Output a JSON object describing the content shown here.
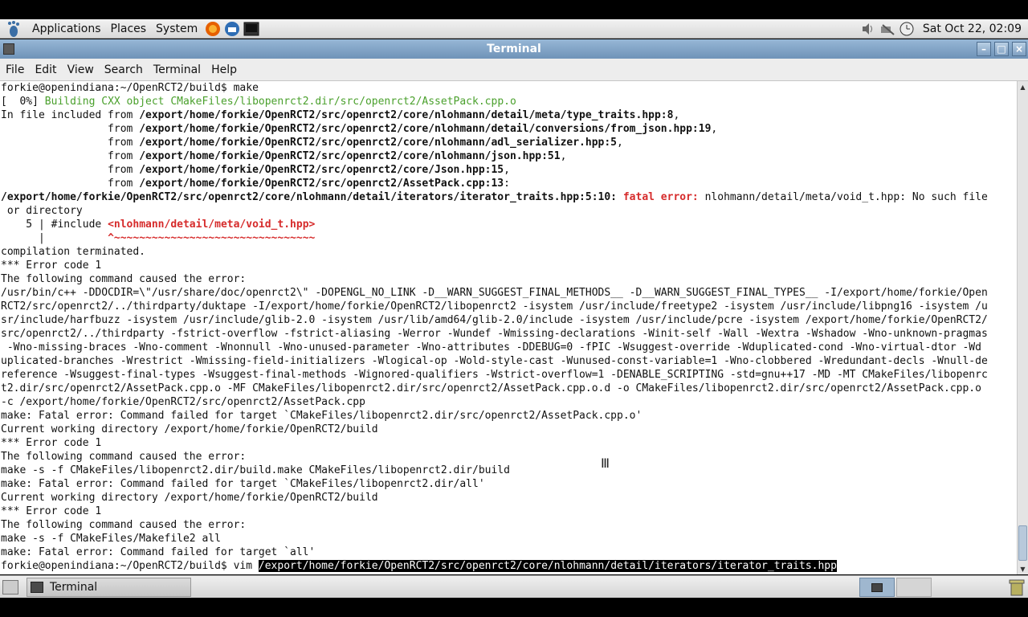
{
  "top_panel": {
    "menus": [
      "Applications",
      "Places",
      "System"
    ],
    "clock": "Sat Oct 22, 02:09"
  },
  "window": {
    "title": "Terminal"
  },
  "menubar": {
    "items": [
      "File",
      "Edit",
      "View",
      "Search",
      "Terminal",
      "Help"
    ]
  },
  "terminal": {
    "lines": [
      {
        "parts": [
          {
            "t": "forkie@openindiana:~/OpenRCT2/build$ make",
            "c": ""
          }
        ]
      },
      {
        "parts": [
          {
            "t": "[  0%] ",
            "c": ""
          },
          {
            "t": "Building CXX object CMakeFiles/libopenrct2.dir/src/openrct2/AssetPack.cpp.o",
            "c": "g"
          }
        ]
      },
      {
        "parts": [
          {
            "t": "In file included from ",
            "c": ""
          },
          {
            "t": "/export/home/forkie/OpenRCT2/src/openrct2/core/nlohmann/detail/meta/type_traits.hpp:8",
            "c": "b"
          },
          {
            "t": ",",
            "c": ""
          }
        ]
      },
      {
        "parts": [
          {
            "t": "                 from ",
            "c": ""
          },
          {
            "t": "/export/home/forkie/OpenRCT2/src/openrct2/core/nlohmann/detail/conversions/from_json.hpp:19",
            "c": "b"
          },
          {
            "t": ",",
            "c": ""
          }
        ]
      },
      {
        "parts": [
          {
            "t": "                 from ",
            "c": ""
          },
          {
            "t": "/export/home/forkie/OpenRCT2/src/openrct2/core/nlohmann/adl_serializer.hpp:5",
            "c": "b"
          },
          {
            "t": ",",
            "c": ""
          }
        ]
      },
      {
        "parts": [
          {
            "t": "                 from ",
            "c": ""
          },
          {
            "t": "/export/home/forkie/OpenRCT2/src/openrct2/core/nlohmann/json.hpp:51",
            "c": "b"
          },
          {
            "t": ",",
            "c": ""
          }
        ]
      },
      {
        "parts": [
          {
            "t": "                 from ",
            "c": ""
          },
          {
            "t": "/export/home/forkie/OpenRCT2/src/openrct2/core/Json.hpp:15",
            "c": "b"
          },
          {
            "t": ",",
            "c": ""
          }
        ]
      },
      {
        "parts": [
          {
            "t": "                 from ",
            "c": ""
          },
          {
            "t": "/export/home/forkie/OpenRCT2/src/openrct2/AssetPack.cpp:13",
            "c": "b"
          },
          {
            "t": ":",
            "c": ""
          }
        ]
      },
      {
        "parts": [
          {
            "t": "/export/home/forkie/OpenRCT2/src/openrct2/core/nlohmann/detail/iterators/iterator_traits.hpp:5:10: ",
            "c": "b"
          },
          {
            "t": "fatal error: ",
            "c": "red"
          },
          {
            "t": "nlohmann/detail/meta/void_t.hpp: No such file",
            "c": ""
          }
        ]
      },
      {
        "parts": [
          {
            "t": " or directory",
            "c": ""
          }
        ]
      },
      {
        "parts": [
          {
            "t": "    5 | #include ",
            "c": ""
          },
          {
            "t": "<nlohmann/detail/meta/void_t.hpp>",
            "c": "red"
          }
        ]
      },
      {
        "parts": [
          {
            "t": "      |          ",
            "c": ""
          },
          {
            "t": "^~~~~~~~~~~~~~~~~~~~~~~~~~~~~~~~~",
            "c": "red"
          }
        ]
      },
      {
        "parts": [
          {
            "t": "compilation terminated.",
            "c": ""
          }
        ]
      },
      {
        "parts": [
          {
            "t": "*** Error code 1",
            "c": ""
          }
        ]
      },
      {
        "parts": [
          {
            "t": "The following command caused the error:",
            "c": ""
          }
        ]
      },
      {
        "parts": [
          {
            "t": "/usr/bin/c++ -DDOCDIR=\\\"/usr/share/doc/openrct2\\\" -DOPENGL_NO_LINK -D__WARN_SUGGEST_FINAL_METHODS__ -D__WARN_SUGGEST_FINAL_TYPES__ -I/export/home/forkie/Open",
            "c": ""
          }
        ]
      },
      {
        "parts": [
          {
            "t": "RCT2/src/openrct2/../thirdparty/duktape -I/export/home/forkie/OpenRCT2/libopenrct2 -isystem /usr/include/freetype2 -isystem /usr/include/libpng16 -isystem /u",
            "c": ""
          }
        ]
      },
      {
        "parts": [
          {
            "t": "sr/include/harfbuzz -isystem /usr/include/glib-2.0 -isystem /usr/lib/amd64/glib-2.0/include -isystem /usr/include/pcre -isystem /export/home/forkie/OpenRCT2/",
            "c": ""
          }
        ]
      },
      {
        "parts": [
          {
            "t": "src/openrct2/../thirdparty -fstrict-overflow -fstrict-aliasing -Werror -Wundef -Wmissing-declarations -Winit-self -Wall -Wextra -Wshadow -Wno-unknown-pragmas",
            "c": ""
          }
        ]
      },
      {
        "parts": [
          {
            "t": " -Wno-missing-braces -Wno-comment -Wnonnull -Wno-unused-parameter -Wno-attributes -DDEBUG=0 -fPIC -Wsuggest-override -Wduplicated-cond -Wno-virtual-dtor -Wd",
            "c": ""
          }
        ]
      },
      {
        "parts": [
          {
            "t": "uplicated-branches -Wrestrict -Wmissing-field-initializers -Wlogical-op -Wold-style-cast -Wunused-const-variable=1 -Wno-clobbered -Wredundant-decls -Wnull-de",
            "c": ""
          }
        ]
      },
      {
        "parts": [
          {
            "t": "reference -Wsuggest-final-types -Wsuggest-final-methods -Wignored-qualifiers -Wstrict-overflow=1 -DENABLE_SCRIPTING -std=gnu++17 -MD -MT CMakeFiles/libopenrc",
            "c": ""
          }
        ]
      },
      {
        "parts": [
          {
            "t": "t2.dir/src/openrct2/AssetPack.cpp.o -MF CMakeFiles/libopenrct2.dir/src/openrct2/AssetPack.cpp.o.d -o CMakeFiles/libopenrct2.dir/src/openrct2/AssetPack.cpp.o",
            "c": ""
          }
        ]
      },
      {
        "parts": [
          {
            "t": "-c /export/home/forkie/OpenRCT2/src/openrct2/AssetPack.cpp",
            "c": ""
          }
        ]
      },
      {
        "parts": [
          {
            "t": "make: Fatal error: Command failed for target `CMakeFiles/libopenrct2.dir/src/openrct2/AssetPack.cpp.o'",
            "c": ""
          }
        ]
      },
      {
        "parts": [
          {
            "t": "Current working directory /export/home/forkie/OpenRCT2/build",
            "c": ""
          }
        ]
      },
      {
        "parts": [
          {
            "t": "*** Error code 1",
            "c": ""
          }
        ]
      },
      {
        "parts": [
          {
            "t": "The following command caused the error:",
            "c": ""
          }
        ]
      },
      {
        "parts": [
          {
            "t": "make -s -f CMakeFiles/libopenrct2.dir/build.make CMakeFiles/libopenrct2.dir/build",
            "c": ""
          }
        ]
      },
      {
        "parts": [
          {
            "t": "make: Fatal error: Command failed for target `CMakeFiles/libopenrct2.dir/all'",
            "c": ""
          }
        ]
      },
      {
        "parts": [
          {
            "t": "Current working directory /export/home/forkie/OpenRCT2/build",
            "c": ""
          }
        ]
      },
      {
        "parts": [
          {
            "t": "*** Error code 1",
            "c": ""
          }
        ]
      },
      {
        "parts": [
          {
            "t": "The following command caused the error:",
            "c": ""
          }
        ]
      },
      {
        "parts": [
          {
            "t": "make -s -f CMakeFiles/Makefile2 all",
            "c": ""
          }
        ]
      },
      {
        "parts": [
          {
            "t": "make: Fatal error: Command failed for target `all'",
            "c": ""
          }
        ]
      },
      {
        "parts": [
          {
            "t": "forkie@openindiana:~/OpenRCT2/build$ vim ",
            "c": ""
          },
          {
            "t": "/export/home/forkie/OpenRCT2/src/openrct2/core/nlohmann/detail/iterators/iterator_traits.hpp",
            "c": "sel"
          }
        ]
      }
    ]
  },
  "taskbar": {
    "task_label": "Terminal"
  },
  "colors": {
    "titlebar": "#6f93b8",
    "build_green": "#4aa02c",
    "error_red": "#d62b2b"
  }
}
